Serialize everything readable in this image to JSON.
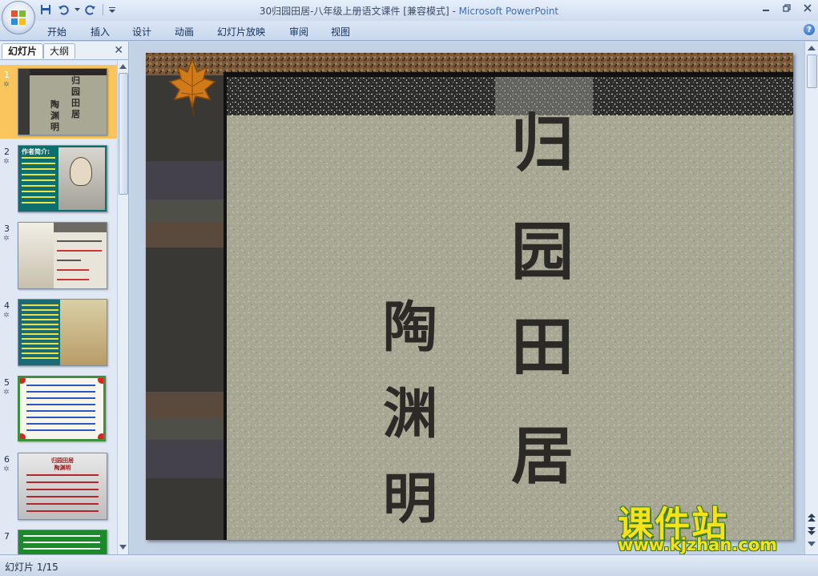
{
  "window": {
    "title": "30归园田居-八年级上册语文课件 [兼容模式]",
    "title_separator": " - ",
    "app_name": "Microsoft PowerPoint"
  },
  "ribbon": {
    "tabs": [
      "开始",
      "插入",
      "设计",
      "动画",
      "幻灯片放映",
      "审阅",
      "视图"
    ],
    "help_glyph": "?"
  },
  "pane": {
    "tabs": [
      "幻灯片",
      "大纲"
    ],
    "close_glyph": "✕"
  },
  "thumbnails": [
    {
      "num": "1",
      "title_text": "归园田居",
      "author_text": "陶渊明"
    },
    {
      "num": "2",
      "title_text": "作者简介:"
    },
    {
      "num": "3"
    },
    {
      "num": "4"
    },
    {
      "num": "5"
    },
    {
      "num": "6",
      "title_text": "归园田居",
      "author_text": "陶渊明"
    },
    {
      "num": "7"
    }
  ],
  "slide": {
    "title_chars": [
      "归",
      "园",
      "田",
      "居"
    ],
    "author_chars": [
      "陶",
      "渊",
      "明"
    ]
  },
  "watermark": {
    "title": "课件站",
    "url": "www.kjzhan.com"
  },
  "status": {
    "slide_indicator": "幻灯片 1/15"
  },
  "colors": {
    "selected_thumb": "#f9c55c",
    "slide_paper": "#a9a895",
    "watermark_yellow": "#f4e21a"
  }
}
